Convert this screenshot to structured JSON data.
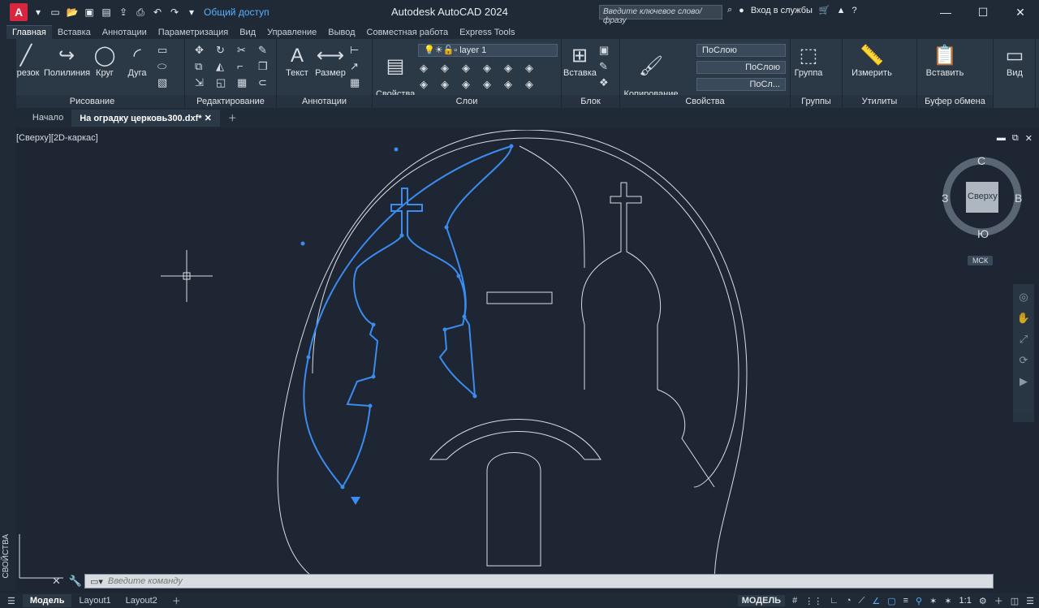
{
  "titlebar": {
    "logo": "A",
    "share_label": "Общий доступ",
    "title": "Autodesk AutoCAD 2024",
    "search_placeholder": "Введите ключевое слово/фразу",
    "signin": "Вход в службы",
    "help": "?"
  },
  "ribbon_tabs": [
    "Главная",
    "Вставка",
    "Аннотации",
    "Параметризация",
    "Вид",
    "Управление",
    "Вывод",
    "Совместная работа",
    "Express Tools"
  ],
  "ribbon": {
    "draw": {
      "title": "Рисование",
      "line": "трезок",
      "polyline": "Полилиния",
      "circle": "Круг",
      "arc": "Дуга"
    },
    "modify": {
      "title": "Редактирование"
    },
    "annotation": {
      "title": "Аннотации",
      "text": "Текст",
      "dimension": "Размер"
    },
    "layers": {
      "title": "Слои",
      "properties": "Свойства\nслоя",
      "current_layer": "layer 1"
    },
    "block": {
      "title": "Блок",
      "insert": "Вставка"
    },
    "properties": {
      "title": "Свойства",
      "match": "Копирование\nсвойства",
      "color": "ПоСлою",
      "linetype": "ПоСлою",
      "lineweight": "ПоСл..."
    },
    "groups": {
      "title": "Группы",
      "group": "Группа"
    },
    "utilities": {
      "title": "Утилиты",
      "measure": "Измерить"
    },
    "clipboard": {
      "title": "Буфер обмена",
      "paste": "Вставить"
    },
    "view": {
      "title": "Вид"
    }
  },
  "doctabs": {
    "home": "Начало",
    "file": "На оградку церковь300.dxf*"
  },
  "viewport": {
    "label": "[Сверху][2D-каркас]"
  },
  "viewcube": {
    "north": "С",
    "south": "Ю",
    "east": "В",
    "west": "З",
    "face": "Сверху",
    "wcs": "МСК"
  },
  "left_panel": {
    "label": "СВОЙСТВА"
  },
  "command": {
    "placeholder": "Введите команду"
  },
  "status": {
    "tabs": [
      "Модель",
      "Layout1",
      "Layout2"
    ],
    "model": "МОДЕЛЬ",
    "scale": "1:1"
  }
}
